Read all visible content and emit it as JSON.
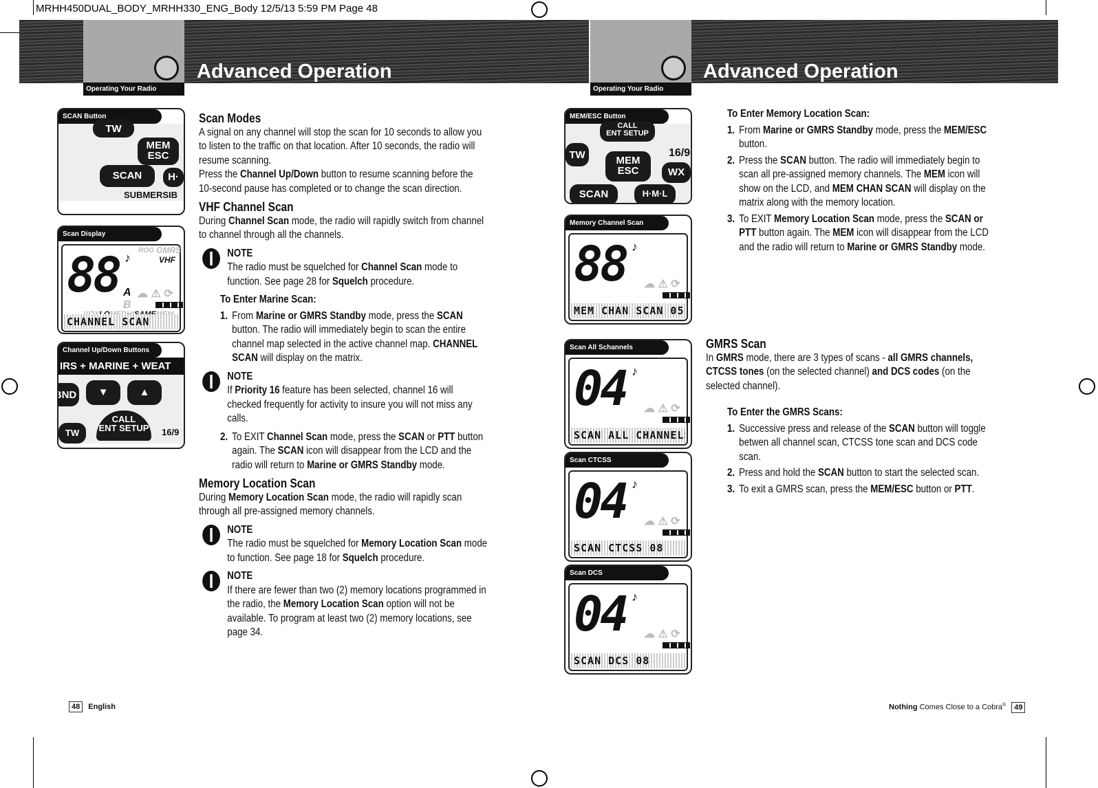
{
  "slug": "MRHH450DUAL_BODY_MRHH330_ENG_Body  12/5/13  5:59 PM  Page 48",
  "left": {
    "section_tab": "Operating Your Radio",
    "title": "Advanced Operation",
    "figures": [
      {
        "caption": "SCAN Button",
        "keys": [
          "TW",
          "MEM\nESC",
          "SCAN",
          "H·",
          "SUBMERSIB"
        ]
      },
      {
        "caption": "Scan Display",
        "digits": "88",
        "matrix": "CHANNEL SCAN",
        "ind": {
          "rog": "ROG",
          "gmrs": "GMRS",
          "vhf": "VHF",
          "a": "A",
          "b": "B",
          "vox": "VOX",
          "lo": "LO",
          "med": "MED",
          "hi": "HI",
          "same": "SAME",
          "mem": "MEM"
        }
      },
      {
        "caption": "Channel Up/Down Buttons",
        "banner": "IRS + MARINE + WEAT",
        "keys": [
          "BND",
          "▼",
          "▲",
          "CALL\nENT SETUP",
          "TW",
          "16/9"
        ]
      }
    ],
    "scan_modes": {
      "heading": "Scan Modes",
      "body": [
        [
          {
            "t": "A signal on any channel will stop the scan for 10 seconds to allow you to listen to the traffic on that location. After 10 seconds, the radio will resume scanning."
          }
        ],
        [
          {
            "t": "Press the "
          },
          {
            "t": "Channel Up/Down",
            "b": 1
          },
          {
            "t": " button to resume scanning before the 10-second pause has completed or to change the scan direction."
          }
        ]
      ]
    },
    "vhf": {
      "heading": "VHF Channel Scan",
      "body": [
        {
          "t": "During "
        },
        {
          "t": "Channel Scan",
          "b": 1
        },
        {
          "t": " mode, the radio will rapidly switch from channel to channel through all the channels."
        }
      ],
      "note1": {
        "label": "NOTE",
        "body": [
          {
            "t": "The radio must be squelched for "
          },
          {
            "t": "Channel Scan",
            "b": 1
          },
          {
            "t": " mode to function. See page 28 for "
          },
          {
            "t": "Squelch",
            "b": 1
          },
          {
            "t": " procedure."
          }
        ]
      },
      "subhead": "To Enter Marine Scan:",
      "step1": {
        "n": "1.",
        "body": [
          {
            "t": "From "
          },
          {
            "t": "Marine or GMRS Standby",
            "b": 1
          },
          {
            "t": " mode, press the "
          },
          {
            "t": "SCAN",
            "b": 1
          },
          {
            "t": " button. The radio will immediately begin to scan the entire channel map selected in the active channel map. "
          },
          {
            "t": "CHANNEL SCAN",
            "b": 1
          },
          {
            "t": " will display on the matrix."
          }
        ]
      },
      "note2": {
        "label": "NOTE",
        "body": [
          {
            "t": "If "
          },
          {
            "t": "Priority 16",
            "b": 1
          },
          {
            "t": " feature has been selected, channel 16 will checked frequently for activity to insure you will not miss any calls."
          }
        ]
      },
      "step2": {
        "n": "2.",
        "body": [
          {
            "t": "To EXIT "
          },
          {
            "t": "Channel Scan",
            "b": 1
          },
          {
            "t": " mode, press the "
          },
          {
            "t": "SCAN",
            "b": 1
          },
          {
            "t": " or "
          },
          {
            "t": "PTT",
            "b": 1
          },
          {
            "t": " button again. The "
          },
          {
            "t": "SCAN",
            "b": 1
          },
          {
            "t": " icon will disappear from the LCD and the radio will return to "
          },
          {
            "t": "Marine or GMRS Standby",
            "b": 1
          },
          {
            "t": " mode."
          }
        ]
      }
    },
    "memory": {
      "heading": "Memory Location Scan",
      "body": [
        {
          "t": "During "
        },
        {
          "t": "Memory Location Scan",
          "b": 1
        },
        {
          "t": " mode, the radio will rapidly scan through all pre-assigned memory channels."
        }
      ],
      "note1": {
        "label": "NOTE",
        "body": [
          {
            "t": "The radio must be squelched for "
          },
          {
            "t": "Memory Location Scan",
            "b": 1
          },
          {
            "t": " mode to function. See page 18 for "
          },
          {
            "t": "Squelch",
            "b": 1
          },
          {
            "t": " procedure."
          }
        ]
      },
      "note2": {
        "label": "NOTE",
        "body": [
          {
            "t": "If there are fewer than two (2) memory locations programmed in the radio, the "
          },
          {
            "t": "Memory Location Scan",
            "b": 1
          },
          {
            "t": " option will not be available. To program at least two (2) memory locations, see page 34."
          }
        ]
      }
    },
    "footer": {
      "page": "48",
      "lang": "English"
    }
  },
  "right": {
    "section_tab": "Operating Your Radio",
    "title": "Advanced Operation",
    "figures": [
      {
        "caption": "MEM/ESC Button",
        "keys": [
          "CALL\nENT SETUP",
          "TW",
          "MEM\nESC",
          "16/9",
          "SCAN",
          "H·M·L",
          "WX"
        ]
      },
      {
        "caption": "Memory Channel Scan",
        "digits": "88",
        "matrix": "MEM CHAN SCAN  05"
      },
      {
        "caption": "Scan All Schannels",
        "digits": "04",
        "matrix": "SCAN ALL CHANNELS"
      },
      {
        "caption": "Scan CTCSS",
        "digits": "04",
        "matrix": "SCAN CTCSS  08"
      },
      {
        "caption": "Scan DCS",
        "digits": "04",
        "matrix": "SCAN DCS 08"
      }
    ],
    "mem_enter": {
      "subhead": "To Enter Memory Location Scan:",
      "steps": [
        {
          "n": "1.",
          "body": [
            {
              "t": "From "
            },
            {
              "t": "Marine or GMRS Standby",
              "b": 1
            },
            {
              "t": " mode, press the "
            },
            {
              "t": "MEM/ESC",
              "b": 1
            },
            {
              "t": " button."
            }
          ]
        },
        {
          "n": "2.",
          "body": [
            {
              "t": "Press the "
            },
            {
              "t": "SCAN",
              "b": 1
            },
            {
              "t": " button. The radio will immediately begin to scan all pre-assigned memory channels. The "
            },
            {
              "t": "MEM",
              "b": 1
            },
            {
              "t": " icon will show on the LCD, and "
            },
            {
              "t": "MEM CHAN SCAN",
              "b": 1
            },
            {
              "t": " will display on the matrix along with the memory location."
            }
          ]
        },
        {
          "n": "3.",
          "body": [
            {
              "t": "To EXIT "
            },
            {
              "t": "Memory Location Scan",
              "b": 1
            },
            {
              "t": " mode, press the "
            },
            {
              "t": "SCAN or PTT",
              "b": 1
            },
            {
              "t": " button again. The "
            },
            {
              "t": "MEM",
              "b": 1
            },
            {
              "t": " icon will disappear from the LCD and the radio will return to "
            },
            {
              "t": "Marine or GMRS Standby",
              "b": 1
            },
            {
              "t": " mode."
            }
          ]
        }
      ]
    },
    "gmrs": {
      "heading": "GMRS Scan",
      "body": [
        {
          "t": "In "
        },
        {
          "t": "GMRS",
          "b": 1
        },
        {
          "t": " mode, there are 3 types of scans - "
        },
        {
          "t": "all GMRS channels, CTCSS tones",
          "b": 1
        },
        {
          "t": " (on the selected channel) "
        },
        {
          "t": "and DCS codes",
          "b": 1
        },
        {
          "t": " (on the selected channel)."
        }
      ],
      "subhead": "To Enter the GMRS Scans:",
      "steps": [
        {
          "n": "1.",
          "body": [
            {
              "t": "Successive press and release of the "
            },
            {
              "t": "SCAN",
              "b": 1
            },
            {
              "t": " button will toggle betwen all channel scan, CTCSS tone scan and DCS code scan."
            }
          ]
        },
        {
          "n": "2.",
          "body": [
            {
              "t": "Press and hold the "
            },
            {
              "t": "SCAN",
              "b": 1
            },
            {
              "t": " button to start the selected scan."
            }
          ]
        },
        {
          "n": "3.",
          "body": [
            {
              "t": "To exit a GMRS scan, press the "
            },
            {
              "t": "MEM/ESC",
              "b": 1
            },
            {
              "t": " button or "
            },
            {
              "t": "PTT",
              "b": 1
            },
            {
              "t": "."
            }
          ]
        }
      ]
    },
    "footer": {
      "brand_bold": "Nothing",
      "brand_rest": " Comes Close to a Cobra",
      "reg": "®",
      "page": "49"
    }
  }
}
